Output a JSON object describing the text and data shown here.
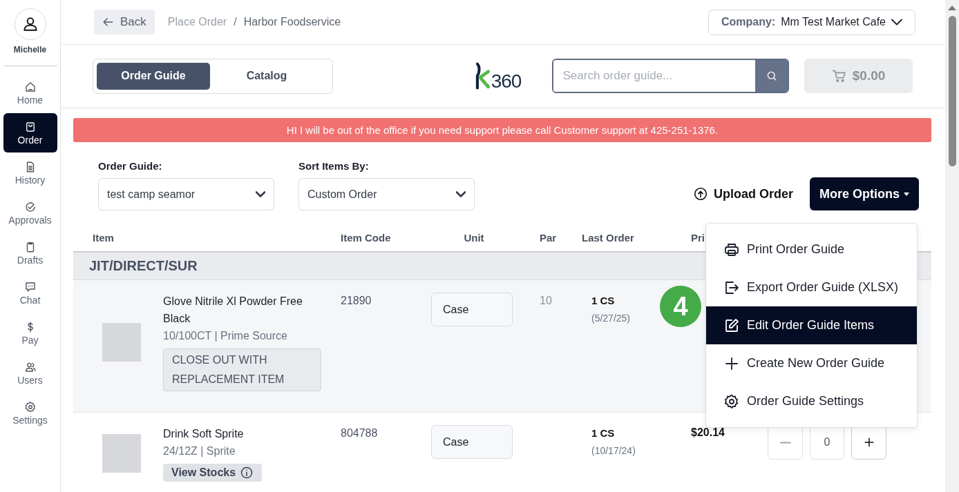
{
  "user": {
    "name": "Michelle"
  },
  "sidebar": {
    "items": [
      {
        "label": "Home",
        "selected": false
      },
      {
        "label": "Order",
        "selected": true
      },
      {
        "label": "History",
        "selected": false
      },
      {
        "label": "Approvals",
        "selected": false
      },
      {
        "label": "Drafts",
        "selected": false
      },
      {
        "label": "Chat",
        "selected": false
      },
      {
        "label": "Pay",
        "selected": false
      },
      {
        "label": "Users",
        "selected": false
      },
      {
        "label": "Settings",
        "selected": false
      }
    ]
  },
  "header": {
    "back": "Back",
    "breadcrumb": [
      "Place Order",
      "Harbor Foodservice"
    ],
    "breadcrumb_separator": "/",
    "company_label": "Company:",
    "company": "Mm Test Market Cafe"
  },
  "tabs": [
    {
      "label": "Order Guide",
      "selected": true
    },
    {
      "label": "Catalog",
      "selected": false
    }
  ],
  "logo": {
    "text": "360"
  },
  "search": {
    "placeholder": "Search order guide..."
  },
  "cart": {
    "total": "$0.00",
    "disabled": true
  },
  "banner": "HI I will be out of the office if you need support please call Customer support at 425-251-1376.",
  "filters": [
    {
      "label": "Order Guide:",
      "value": "test camp seamor"
    },
    {
      "label": "Sort Items By:",
      "value": "Custom Order"
    }
  ],
  "upload": "Upload Order",
  "more_options": "More Options",
  "table": {
    "columns": [
      "Item",
      "Item Code",
      "Unit",
      "Par",
      "Last Order",
      "Pri"
    ],
    "group": "JIT/DIRECT/SUR",
    "rows": [
      {
        "name": "Glove Nitrile Xl Powder Free Black",
        "detail": "10/100CT | Prime Source",
        "code": "21890",
        "unit": "Case",
        "par": "10",
        "last_order": "1 CS",
        "last_date": "(5/27/25)",
        "tag": {
          "kind": "notice",
          "text": "CLOSE OUT WITH REPLACEMENT ITEM"
        }
      },
      {
        "name": "Drink Soft Sprite",
        "detail": "24/12Z | Sprite",
        "code": "804788",
        "unit": "Case",
        "last_order": "1 CS",
        "last_date": "(10/17/24)",
        "price": "$20.14",
        "tag": {
          "kind": "button",
          "text": "View Stocks"
        },
        "quantity": "0",
        "minus_disabled": true
      }
    ]
  },
  "menu": [
    {
      "label": "Print Order Guide",
      "selected": false
    },
    {
      "label": "Export Order Guide (XLSX)",
      "selected": false
    },
    {
      "label": "Edit Order Guide Items",
      "selected": true
    },
    {
      "label": "Create New Order Guide",
      "selected": false
    },
    {
      "label": "Order Guide Settings",
      "selected": false
    }
  ],
  "step_badge": "4"
}
